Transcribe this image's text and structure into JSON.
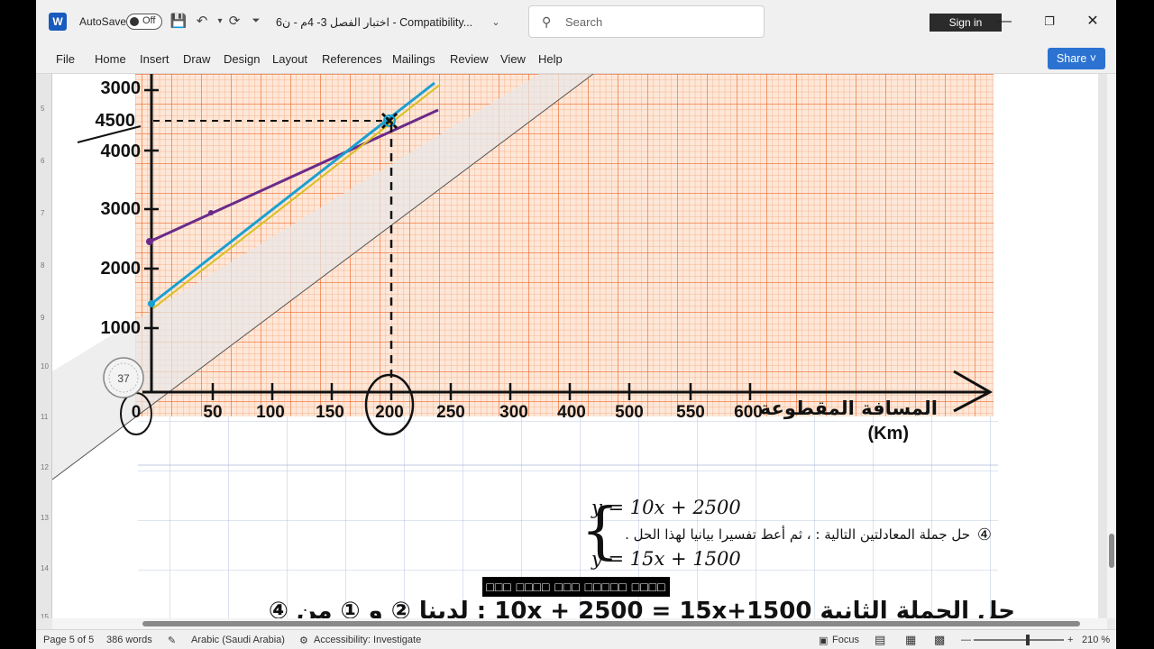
{
  "titlebar": {
    "autosave_label": "AutoSave",
    "autosave_state": "Off",
    "doc_title": "اختبار الفصل 3- 4م - ن6  -  Compatibility...",
    "search_placeholder": "Search",
    "signin_label": "Sign in"
  },
  "menu": {
    "items": [
      "File",
      "Home",
      "Insert",
      "Draw",
      "Design",
      "Layout",
      "References",
      "Mailings",
      "Review",
      "View",
      "Help"
    ],
    "share_label": "Share"
  },
  "graph": {
    "y_labels": [
      "3000",
      "4500",
      "4000",
      "3000",
      "2000",
      "1000"
    ],
    "x_labels": [
      "0",
      "50",
      "100",
      "150",
      "200",
      "250",
      "300",
      "400",
      "500",
      "550",
      "600"
    ],
    "x_axis_title": "المسافة المقطوعة",
    "x_axis_unit": "(Km)",
    "ruler_value": "37"
  },
  "question": {
    "number": "④",
    "text": "حل جملة المعادلتين التالية :  ،  ثم أعط تفسيرا بيانيا لهذا الحل .",
    "eq1": "y = 10x + 2500",
    "eq2": "y =  15x + 1500"
  },
  "handwriting": {
    "line": "حل الجملة الثانية  10x + 2500 = 15x+1500 : لدينا  ② و ① من ④"
  },
  "caption": "□□□ □□□□ □□□ □□□□□ □□□□",
  "statusbar": {
    "page": "Page 5 of 5",
    "words": "386 words",
    "language": "Arabic (Saudi Arabia)",
    "accessibility": "Accessibility: Investigate",
    "focus": "Focus",
    "zoom": "210 %"
  }
}
